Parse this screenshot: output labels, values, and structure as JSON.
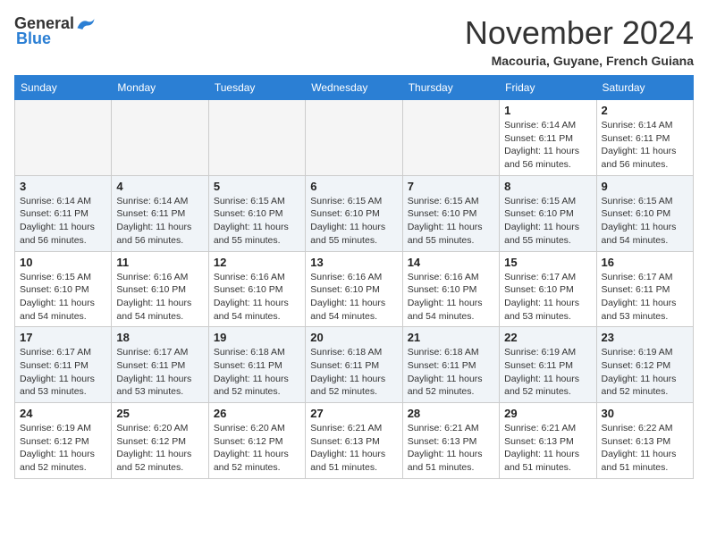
{
  "header": {
    "logo_general": "General",
    "logo_blue": "Blue",
    "month_title": "November 2024",
    "location": "Macouria, Guyane, French Guiana"
  },
  "weekdays": [
    "Sunday",
    "Monday",
    "Tuesday",
    "Wednesday",
    "Thursday",
    "Friday",
    "Saturday"
  ],
  "weeks": [
    [
      {
        "day": "",
        "info": "",
        "empty": true
      },
      {
        "day": "",
        "info": "",
        "empty": true
      },
      {
        "day": "",
        "info": "",
        "empty": true
      },
      {
        "day": "",
        "info": "",
        "empty": true
      },
      {
        "day": "",
        "info": "",
        "empty": true
      },
      {
        "day": "1",
        "info": "Sunrise: 6:14 AM\nSunset: 6:11 PM\nDaylight: 11 hours\nand 56 minutes.",
        "empty": false
      },
      {
        "day": "2",
        "info": "Sunrise: 6:14 AM\nSunset: 6:11 PM\nDaylight: 11 hours\nand 56 minutes.",
        "empty": false
      }
    ],
    [
      {
        "day": "3",
        "info": "Sunrise: 6:14 AM\nSunset: 6:11 PM\nDaylight: 11 hours\nand 56 minutes.",
        "empty": false
      },
      {
        "day": "4",
        "info": "Sunrise: 6:14 AM\nSunset: 6:11 PM\nDaylight: 11 hours\nand 56 minutes.",
        "empty": false
      },
      {
        "day": "5",
        "info": "Sunrise: 6:15 AM\nSunset: 6:10 PM\nDaylight: 11 hours\nand 55 minutes.",
        "empty": false
      },
      {
        "day": "6",
        "info": "Sunrise: 6:15 AM\nSunset: 6:10 PM\nDaylight: 11 hours\nand 55 minutes.",
        "empty": false
      },
      {
        "day": "7",
        "info": "Sunrise: 6:15 AM\nSunset: 6:10 PM\nDaylight: 11 hours\nand 55 minutes.",
        "empty": false
      },
      {
        "day": "8",
        "info": "Sunrise: 6:15 AM\nSunset: 6:10 PM\nDaylight: 11 hours\nand 55 minutes.",
        "empty": false
      },
      {
        "day": "9",
        "info": "Sunrise: 6:15 AM\nSunset: 6:10 PM\nDaylight: 11 hours\nand 54 minutes.",
        "empty": false
      }
    ],
    [
      {
        "day": "10",
        "info": "Sunrise: 6:15 AM\nSunset: 6:10 PM\nDaylight: 11 hours\nand 54 minutes.",
        "empty": false
      },
      {
        "day": "11",
        "info": "Sunrise: 6:16 AM\nSunset: 6:10 PM\nDaylight: 11 hours\nand 54 minutes.",
        "empty": false
      },
      {
        "day": "12",
        "info": "Sunrise: 6:16 AM\nSunset: 6:10 PM\nDaylight: 11 hours\nand 54 minutes.",
        "empty": false
      },
      {
        "day": "13",
        "info": "Sunrise: 6:16 AM\nSunset: 6:10 PM\nDaylight: 11 hours\nand 54 minutes.",
        "empty": false
      },
      {
        "day": "14",
        "info": "Sunrise: 6:16 AM\nSunset: 6:10 PM\nDaylight: 11 hours\nand 54 minutes.",
        "empty": false
      },
      {
        "day": "15",
        "info": "Sunrise: 6:17 AM\nSunset: 6:10 PM\nDaylight: 11 hours\nand 53 minutes.",
        "empty": false
      },
      {
        "day": "16",
        "info": "Sunrise: 6:17 AM\nSunset: 6:11 PM\nDaylight: 11 hours\nand 53 minutes.",
        "empty": false
      }
    ],
    [
      {
        "day": "17",
        "info": "Sunrise: 6:17 AM\nSunset: 6:11 PM\nDaylight: 11 hours\nand 53 minutes.",
        "empty": false
      },
      {
        "day": "18",
        "info": "Sunrise: 6:17 AM\nSunset: 6:11 PM\nDaylight: 11 hours\nand 53 minutes.",
        "empty": false
      },
      {
        "day": "19",
        "info": "Sunrise: 6:18 AM\nSunset: 6:11 PM\nDaylight: 11 hours\nand 52 minutes.",
        "empty": false
      },
      {
        "day": "20",
        "info": "Sunrise: 6:18 AM\nSunset: 6:11 PM\nDaylight: 11 hours\nand 52 minutes.",
        "empty": false
      },
      {
        "day": "21",
        "info": "Sunrise: 6:18 AM\nSunset: 6:11 PM\nDaylight: 11 hours\nand 52 minutes.",
        "empty": false
      },
      {
        "day": "22",
        "info": "Sunrise: 6:19 AM\nSunset: 6:11 PM\nDaylight: 11 hours\nand 52 minutes.",
        "empty": false
      },
      {
        "day": "23",
        "info": "Sunrise: 6:19 AM\nSunset: 6:12 PM\nDaylight: 11 hours\nand 52 minutes.",
        "empty": false
      }
    ],
    [
      {
        "day": "24",
        "info": "Sunrise: 6:19 AM\nSunset: 6:12 PM\nDaylight: 11 hours\nand 52 minutes.",
        "empty": false
      },
      {
        "day": "25",
        "info": "Sunrise: 6:20 AM\nSunset: 6:12 PM\nDaylight: 11 hours\nand 52 minutes.",
        "empty": false
      },
      {
        "day": "26",
        "info": "Sunrise: 6:20 AM\nSunset: 6:12 PM\nDaylight: 11 hours\nand 52 minutes.",
        "empty": false
      },
      {
        "day": "27",
        "info": "Sunrise: 6:21 AM\nSunset: 6:13 PM\nDaylight: 11 hours\nand 51 minutes.",
        "empty": false
      },
      {
        "day": "28",
        "info": "Sunrise: 6:21 AM\nSunset: 6:13 PM\nDaylight: 11 hours\nand 51 minutes.",
        "empty": false
      },
      {
        "day": "29",
        "info": "Sunrise: 6:21 AM\nSunset: 6:13 PM\nDaylight: 11 hours\nand 51 minutes.",
        "empty": false
      },
      {
        "day": "30",
        "info": "Sunrise: 6:22 AM\nSunset: 6:13 PM\nDaylight: 11 hours\nand 51 minutes.",
        "empty": false
      }
    ]
  ]
}
